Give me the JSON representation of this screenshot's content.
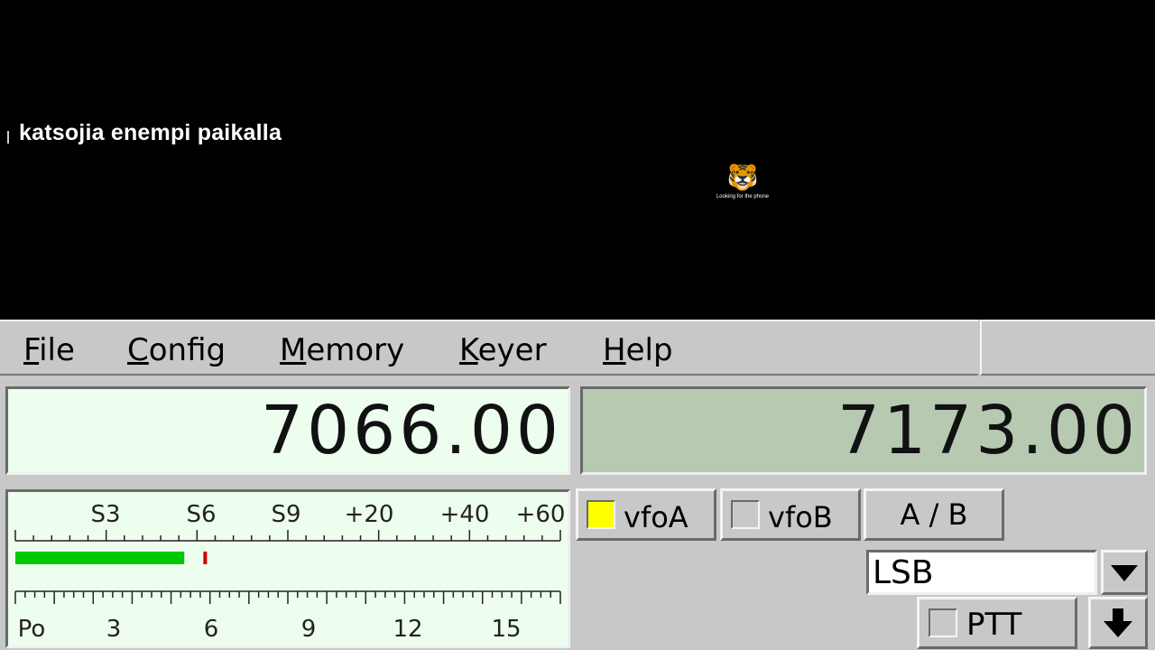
{
  "video": {
    "caption": "katsojia enempi paikalla",
    "overlay_text": "Looking for the phone",
    "overlay_icon": "tiger-cat-icon"
  },
  "menu": {
    "items": [
      {
        "first": "F",
        "rest": "ile"
      },
      {
        "first": "C",
        "rest": "onfig"
      },
      {
        "first": "M",
        "rest": "emory"
      },
      {
        "first": "K",
        "rest": "eyer"
      },
      {
        "first": "H",
        "rest": "elp"
      }
    ]
  },
  "vfo": {
    "a_freq": "7066.00",
    "b_freq": "7173.00",
    "vfoa_label": "vfoA",
    "vfob_label": "vfoB",
    "ab_label": "A / B",
    "active": "A"
  },
  "meter": {
    "s_labels": [
      "S3",
      "S6",
      "S9",
      "+20",
      "+40",
      "+60"
    ],
    "po_labels": [
      "Po",
      "3",
      "6",
      "9",
      "12",
      "15"
    ],
    "signal_fraction": 0.31,
    "peak_fraction": 0.345,
    "bar_color": "#00c800",
    "peak_color": "#d00000"
  },
  "mode": {
    "value": "LSB"
  },
  "ptt": {
    "label": "PTT"
  },
  "colors": {
    "display_active": "#eefeee",
    "display_inactive": "#b7c9b1",
    "vfoa_indicator": "#ffff00"
  }
}
